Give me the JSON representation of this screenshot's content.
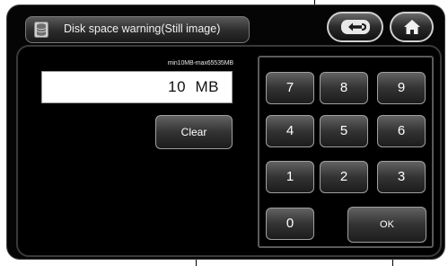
{
  "window": {
    "title": "Disk space warning(Still image)"
  },
  "input": {
    "limits": "min10MB-max65535MB",
    "value": "10",
    "unit": "MB"
  },
  "keypad": {
    "keys": [
      "7",
      "8",
      "9",
      "4",
      "5",
      "6",
      "1",
      "2",
      "3",
      "0"
    ]
  },
  "buttons": {
    "clear": "Clear",
    "ok": "OK"
  },
  "colors": {
    "bezel": "#050505",
    "panel": "#000000",
    "button_text": "#ffffff"
  },
  "icons": {
    "title": "disk-stack-icon",
    "back": "return-arrow-icon",
    "home": "home-icon"
  }
}
